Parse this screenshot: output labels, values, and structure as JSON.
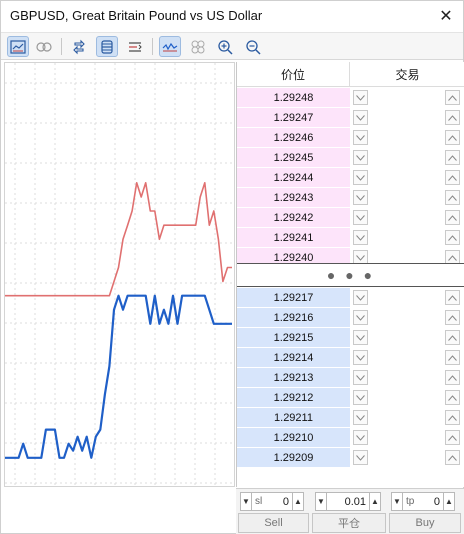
{
  "window": {
    "title": "GBPUSD, Great Britain Pound vs US Dollar",
    "close_glyph": "✕"
  },
  "toolbar": {
    "buttons": [
      {
        "name": "chart-icon",
        "active": true
      },
      {
        "name": "one-click-trading-icon",
        "active": false
      },
      {
        "name": "reverse-icon",
        "active": false
      },
      {
        "name": "center-icon",
        "active": true
      },
      {
        "name": "volumes-icon",
        "active": false
      },
      {
        "name": "tick-chart-icon",
        "active": true
      },
      {
        "name": "circles-icon",
        "active": false
      },
      {
        "name": "zoom-in-icon",
        "active": false
      },
      {
        "name": "zoom-out-icon",
        "active": false
      }
    ]
  },
  "dom": {
    "header": {
      "price": "价位",
      "trade": "交易"
    },
    "asks": [
      "1.29248",
      "1.29247",
      "1.29246",
      "1.29245",
      "1.29244",
      "1.29243",
      "1.29242",
      "1.29241",
      "1.29240"
    ],
    "bids": [
      "1.29217",
      "1.29216",
      "1.29215",
      "1.29214",
      "1.29213",
      "1.29212",
      "1.29211",
      "1.29210",
      "1.29209"
    ],
    "spread_glyph": "● ● ●"
  },
  "order_panel": {
    "sl": {
      "label": "sl",
      "value": "0"
    },
    "volume": {
      "value": "0.01"
    },
    "tp": {
      "label": "tp",
      "value": "0"
    },
    "sell_label": "Sell",
    "close_label": "平仓",
    "buy_label": "Buy"
  },
  "colors": {
    "ask_line": "#e07070",
    "bid_line": "#1f5fc8",
    "ask_bg": "#fde4fa",
    "bid_bg": "#d7e5fb"
  },
  "chart_data": {
    "type": "line",
    "series": [
      {
        "values": [
          1.29232,
          1.29232,
          1.29232,
          1.29232,
          1.29232,
          1.29232,
          1.29232,
          1.29232,
          1.29232,
          1.29232,
          1.29232,
          1.29232,
          1.29232,
          1.29232,
          1.29232,
          1.29232,
          1.29232,
          1.29232,
          1.29232,
          1.29232,
          1.29232,
          1.29232,
          1.29232,
          1.29232,
          1.29234,
          1.29236,
          1.2924,
          1.29242,
          1.29244,
          1.29248,
          1.29246,
          1.29248,
          1.29244,
          1.29244,
          1.2924,
          1.29242,
          1.29242,
          1.29242,
          1.29242,
          1.29242,
          1.29242,
          1.29242,
          1.29242,
          1.29246,
          1.29248,
          1.29242,
          1.29244,
          1.2924,
          1.29234,
          1.29236,
          1.29236
        ]
      },
      {
        "values": [
          1.29209,
          1.29209,
          1.29209,
          1.29209,
          1.29211,
          1.29209,
          1.29209,
          1.29209,
          1.29209,
          1.29213,
          1.29213,
          1.29213,
          1.29209,
          1.29209,
          1.29211,
          1.2921,
          1.29212,
          1.2921,
          1.29212,
          1.29209,
          1.29212,
          1.29213,
          1.29218,
          1.29222,
          1.2923,
          1.29232,
          1.2923,
          1.29232,
          1.29232,
          1.29232,
          1.29232,
          1.29232,
          1.29228,
          1.29232,
          1.29228,
          1.2923,
          1.29228,
          1.29232,
          1.29228,
          1.29232,
          1.29232,
          1.29232,
          1.29232,
          1.29232,
          1.29232,
          1.2923,
          1.29228,
          1.29228,
          1.29228,
          1.29228,
          1.29228
        ]
      }
    ],
    "ylim": [
      1.29205,
      1.29265
    ],
    "grid": true
  }
}
